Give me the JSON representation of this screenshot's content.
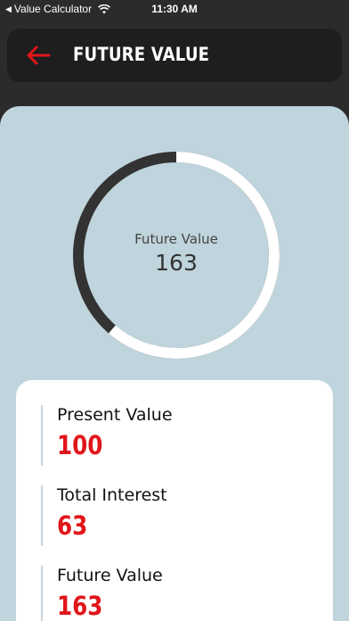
{
  "status_bar": {
    "back_label": "Value Calculator",
    "time": "11:30 AM"
  },
  "header": {
    "title": "FUTURE VALUE",
    "back_icon": "arrow-left-icon"
  },
  "ring": {
    "label": "Future Value",
    "value": "163",
    "present_fraction": 0.6135,
    "colors": {
      "present": "#ffffff",
      "interest": "#333333"
    }
  },
  "summary": {
    "items": [
      {
        "label": "Present Value",
        "value": "100"
      },
      {
        "label": "Total Interest",
        "value": "63"
      },
      {
        "label": "Future Value",
        "value": "163"
      }
    ]
  },
  "colors": {
    "accent": "#e0161b",
    "panel": "#bfd4dc",
    "header": "#1e1e1e"
  }
}
